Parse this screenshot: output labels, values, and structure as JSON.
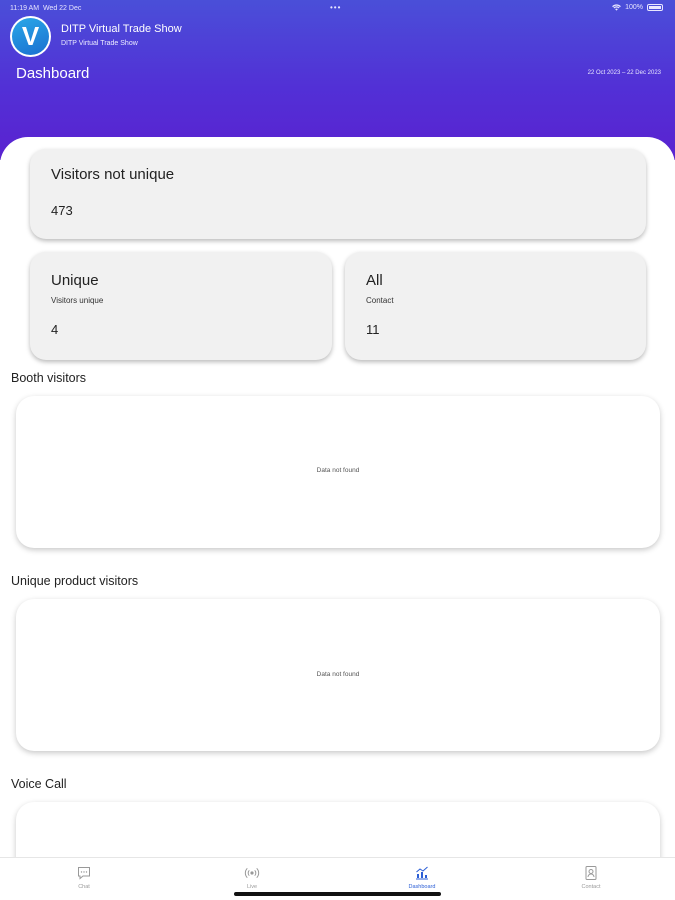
{
  "status_bar": {
    "time": "11:19 AM",
    "date": "Wed 22 Dec",
    "dots": "•••",
    "battery": "100%"
  },
  "header": {
    "app_title": "DITP Virtual Trade Show",
    "app_subtitle": "DITP Virtual Trade Show",
    "page_title": "Dashboard",
    "date_range": "22 Oct 2023  –  22 Dec 2023"
  },
  "cards": {
    "visitors_not_unique": {
      "title": "Visitors not unique",
      "value": "473"
    },
    "unique": {
      "title": "Unique",
      "subtitle": "Visitors unique",
      "value": "4"
    },
    "all": {
      "title": "All",
      "subtitle": "Contact",
      "value": "11"
    }
  },
  "sections": {
    "booth_visitors": {
      "label": "Booth visitors",
      "empty": "Data not found"
    },
    "unique_product_visitors": {
      "label": "Unique product visitors",
      "empty": "Data not found"
    },
    "voice_call": {
      "label": "Voice Call"
    }
  },
  "tabs": [
    {
      "label": "Chat",
      "icon": "chat-icon"
    },
    {
      "label": "Live",
      "icon": "live-icon"
    },
    {
      "label": "Dashboard",
      "icon": "dashboard-icon"
    },
    {
      "label": "Contact",
      "icon": "contact-icon"
    }
  ],
  "colors": {
    "header_gradient_start": "#4a4fd8",
    "header_gradient_end": "#5a22d0",
    "active_tab": "#2c5fd6"
  }
}
